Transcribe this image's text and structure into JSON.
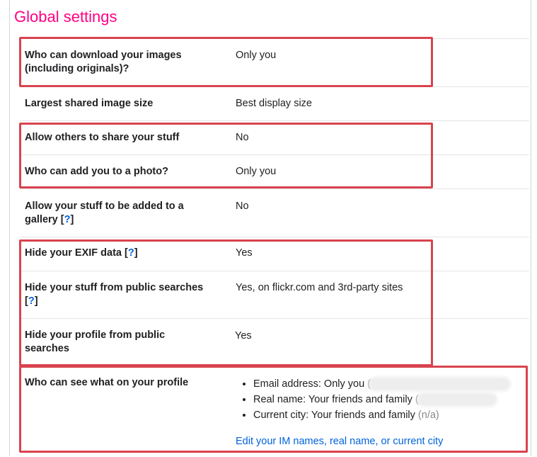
{
  "page_title": "Global settings",
  "accent_colors": {
    "title": "#ff0084",
    "link": "#0063dc",
    "highlight": "#d9434e"
  },
  "settings": {
    "download": {
      "label": "Who can download your images (including originals)?",
      "value": "Only you"
    },
    "share_size": {
      "label": "Largest shared image size",
      "value": "Best display size"
    },
    "allow_share": {
      "label": "Allow others to share your stuff",
      "value": "No"
    },
    "add_to_photo": {
      "label": "Who can add you to a photo?",
      "value": "Only you"
    },
    "gallery": {
      "label": "Allow your stuff to be added to a gallery",
      "help": "?",
      "value": "No"
    },
    "exif": {
      "label": "Hide your EXIF data",
      "help": "?",
      "value": "Yes"
    },
    "public_search_stuff": {
      "label": "Hide your stuff from public searches",
      "help": "?",
      "value": "Yes, on flickr.com and 3rd-party sites"
    },
    "public_search_profile": {
      "label": "Hide your profile from public searches",
      "value": "Yes"
    },
    "profile_visibility": {
      "label": "Who can see what on your profile",
      "items": [
        {
          "text": "Email address: Only you",
          "paren": "("
        },
        {
          "text": "Real name: Your friends and family",
          "paren": "("
        },
        {
          "text": "Current city: Your friends and family",
          "paren": "(n/a)"
        }
      ],
      "edit_link": "Edit your IM names, real name, or current city"
    }
  }
}
